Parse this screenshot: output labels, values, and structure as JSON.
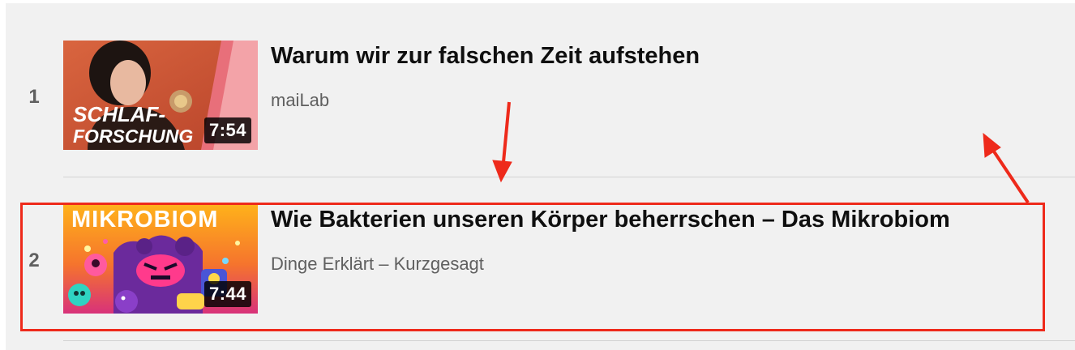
{
  "playlist": {
    "items": [
      {
        "index": "1",
        "title": "Warum wir zur falschen Zeit aufstehen",
        "channel": "maiLab",
        "duration": "7:54",
        "thumbnail_text": [
          "SCHLAF-",
          "FORSCHUNG"
        ]
      },
      {
        "index": "2",
        "title": "Wie Bakterien unseren Körper beherrschen – Das Mikrobiom",
        "channel": "Dinge Erklärt – Kurzgesagt",
        "duration": "7:44",
        "thumbnail_text": [
          "MIKROBIOM"
        ]
      }
    ]
  },
  "annotation": {
    "color": "#ee2a1b"
  }
}
